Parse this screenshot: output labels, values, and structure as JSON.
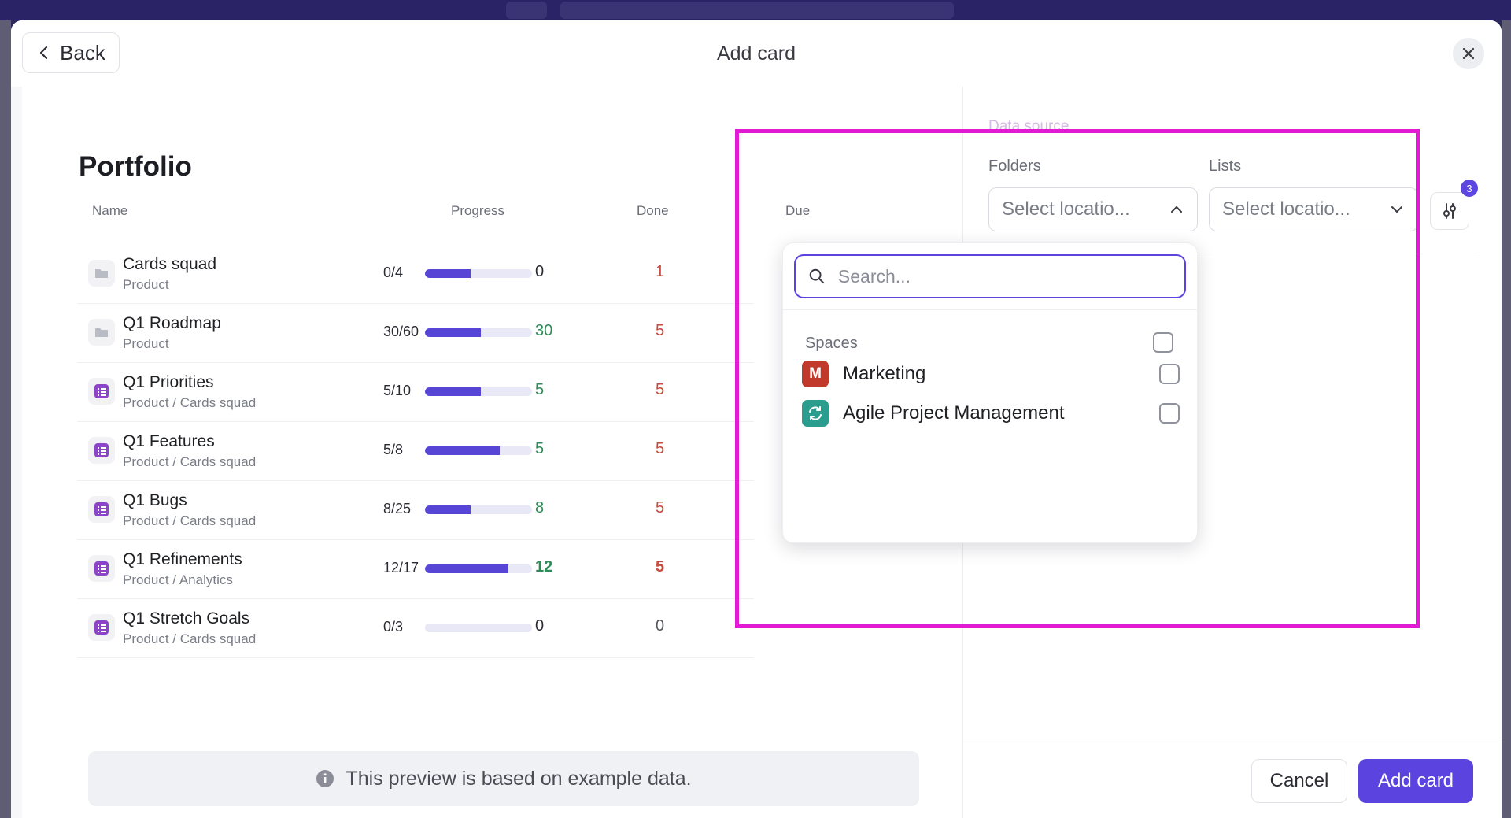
{
  "modal": {
    "title": "Add card",
    "back_label": "Back"
  },
  "preview": {
    "title": "Portfolio",
    "columns": {
      "name": "Name",
      "progress": "Progress",
      "done": "Done",
      "due": "Due"
    },
    "rows": [
      {
        "name": "Cards squad",
        "path": "Product",
        "icon": "folder-icon",
        "progress": "0/4",
        "progress_fraction": 0.43,
        "done": "0",
        "due": "1"
      },
      {
        "name": "Q1 Roadmap",
        "path": "Product",
        "icon": "folder-icon",
        "progress": "30/60",
        "progress_fraction": 0.52,
        "done": "30",
        "due": "5"
      },
      {
        "name": "Q1 Priorities",
        "path": "Product / Cards squad",
        "icon": "list-icon",
        "progress": "5/10",
        "progress_fraction": 0.52,
        "done": "5",
        "due": "5"
      },
      {
        "name": "Q1 Features",
        "path": "Product / Cards squad",
        "icon": "list-icon",
        "progress": "5/8",
        "progress_fraction": 0.7,
        "done": "5",
        "due": "5"
      },
      {
        "name": "Q1 Bugs",
        "path": "Product / Cards squad",
        "icon": "list-icon",
        "progress": "8/25",
        "progress_fraction": 0.43,
        "done": "8",
        "due": "5"
      },
      {
        "name": "Q1 Refinements",
        "path": "Product / Analytics",
        "icon": "list-icon",
        "progress": "12/17",
        "progress_fraction": 0.78,
        "done": "12",
        "due": "5"
      },
      {
        "name": "Q1 Stretch Goals",
        "path": "Product / Cards squad",
        "icon": "list-icon",
        "progress": "0/3",
        "progress_fraction": 0,
        "done": "0",
        "due": "0"
      }
    ],
    "note": "This preview is based on example data."
  },
  "data_source": {
    "label": "Data source",
    "folders_label": "Folders",
    "folders_value": "Select locatio...",
    "lists_label": "Lists",
    "lists_value": "Select locatio...",
    "filter_badge": "3"
  },
  "dropdown": {
    "search_placeholder": "Search...",
    "section_label": "Spaces",
    "items": [
      {
        "label": "Marketing",
        "avatar": "M",
        "color": "#c0392b",
        "checked": false
      },
      {
        "label": "Agile Project Management",
        "icon": "sync-icon",
        "color": "#2a9d8f",
        "checked": false
      }
    ]
  },
  "footer": {
    "cancel_label": "Cancel",
    "add_label": "Add card"
  },
  "colors": {
    "accent": "#5b43e0",
    "highlight": "#e21ad3",
    "done_green": "#2e8b57",
    "due_red": "#c84a3b"
  }
}
